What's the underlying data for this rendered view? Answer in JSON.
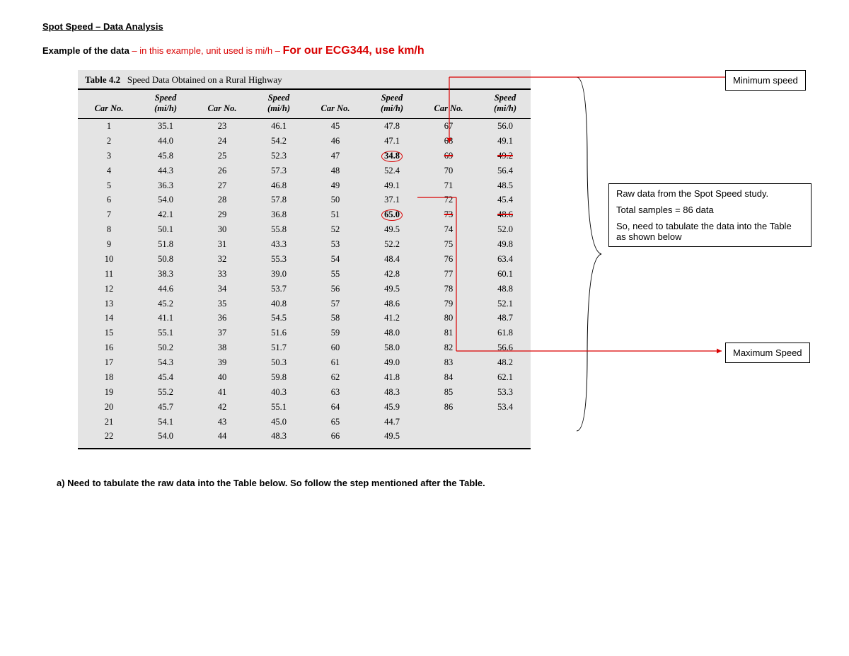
{
  "heading": "Spot Speed – Data Analysis",
  "example_prefix": "Example of the data",
  "example_mid": " – in this example, unit used is mi/h – ",
  "example_bold": "For our ECG344, use km/h",
  "table_label": "Table 4.2",
  "table_title": "Speed Data Obtained on a Rural Highway",
  "col_car": "Car No.",
  "col_speed_1": "Speed",
  "col_speed_2": "(mi/h)",
  "min_box": "Minimum speed",
  "max_box": "Maximum Speed",
  "raw_1": "Raw data from the Spot Speed study.",
  "raw_2": "Total samples = 86 data",
  "raw_3": "So, need to tabulate the data into the Table as shown below",
  "footer": "a)  Need to tabulate the raw data into the Table below. So follow the step mentioned after the Table.",
  "rows": [
    [
      1,
      "35.1",
      23,
      "46.1",
      45,
      "47.8",
      67,
      "56.0"
    ],
    [
      2,
      "44.0",
      24,
      "54.2",
      46,
      "47.1",
      68,
      "49.1"
    ],
    [
      3,
      "45.8",
      25,
      "52.3",
      47,
      "34.8",
      69,
      "49.2"
    ],
    [
      4,
      "44.3",
      26,
      "57.3",
      48,
      "52.4",
      70,
      "56.4"
    ],
    [
      5,
      "36.3",
      27,
      "46.8",
      49,
      "49.1",
      71,
      "48.5"
    ],
    [
      6,
      "54.0",
      28,
      "57.8",
      50,
      "37.1",
      72,
      "45.4"
    ],
    [
      7,
      "42.1",
      29,
      "36.8",
      51,
      "65.0",
      73,
      "48.6"
    ],
    [
      8,
      "50.1",
      30,
      "55.8",
      52,
      "49.5",
      74,
      "52.0"
    ],
    [
      9,
      "51.8",
      31,
      "43.3",
      53,
      "52.2",
      75,
      "49.8"
    ],
    [
      10,
      "50.8",
      32,
      "55.3",
      54,
      "48.4",
      76,
      "63.4"
    ],
    [
      11,
      "38.3",
      33,
      "39.0",
      55,
      "42.8",
      77,
      "60.1"
    ],
    [
      12,
      "44.6",
      34,
      "53.7",
      56,
      "49.5",
      78,
      "48.8"
    ],
    [
      13,
      "45.2",
      35,
      "40.8",
      57,
      "48.6",
      79,
      "52.1"
    ],
    [
      14,
      "41.1",
      36,
      "54.5",
      58,
      "41.2",
      80,
      "48.7"
    ],
    [
      15,
      "55.1",
      37,
      "51.6",
      59,
      "48.0",
      81,
      "61.8"
    ],
    [
      16,
      "50.2",
      38,
      "51.7",
      60,
      "58.0",
      82,
      "56.6"
    ],
    [
      17,
      "54.3",
      39,
      "50.3",
      61,
      "49.0",
      83,
      "48.2"
    ],
    [
      18,
      "45.4",
      40,
      "59.8",
      62,
      "41.8",
      84,
      "62.1"
    ],
    [
      19,
      "55.2",
      41,
      "40.3",
      63,
      "48.3",
      85,
      "53.3"
    ],
    [
      20,
      "45.7",
      42,
      "55.1",
      64,
      "45.9",
      86,
      "53.4"
    ],
    [
      21,
      "54.1",
      43,
      "45.0",
      65,
      "44.7",
      "",
      ""
    ],
    [
      22,
      "54.0",
      44,
      "48.3",
      66,
      "49.5",
      "",
      ""
    ]
  ],
  "min_highlight": {
    "row": 2,
    "col": 5
  },
  "max_highlight": {
    "row": 6,
    "col": 5
  },
  "strike_cells": [
    [
      2,
      6
    ],
    [
      2,
      7
    ],
    [
      6,
      6
    ],
    [
      6,
      7
    ]
  ]
}
